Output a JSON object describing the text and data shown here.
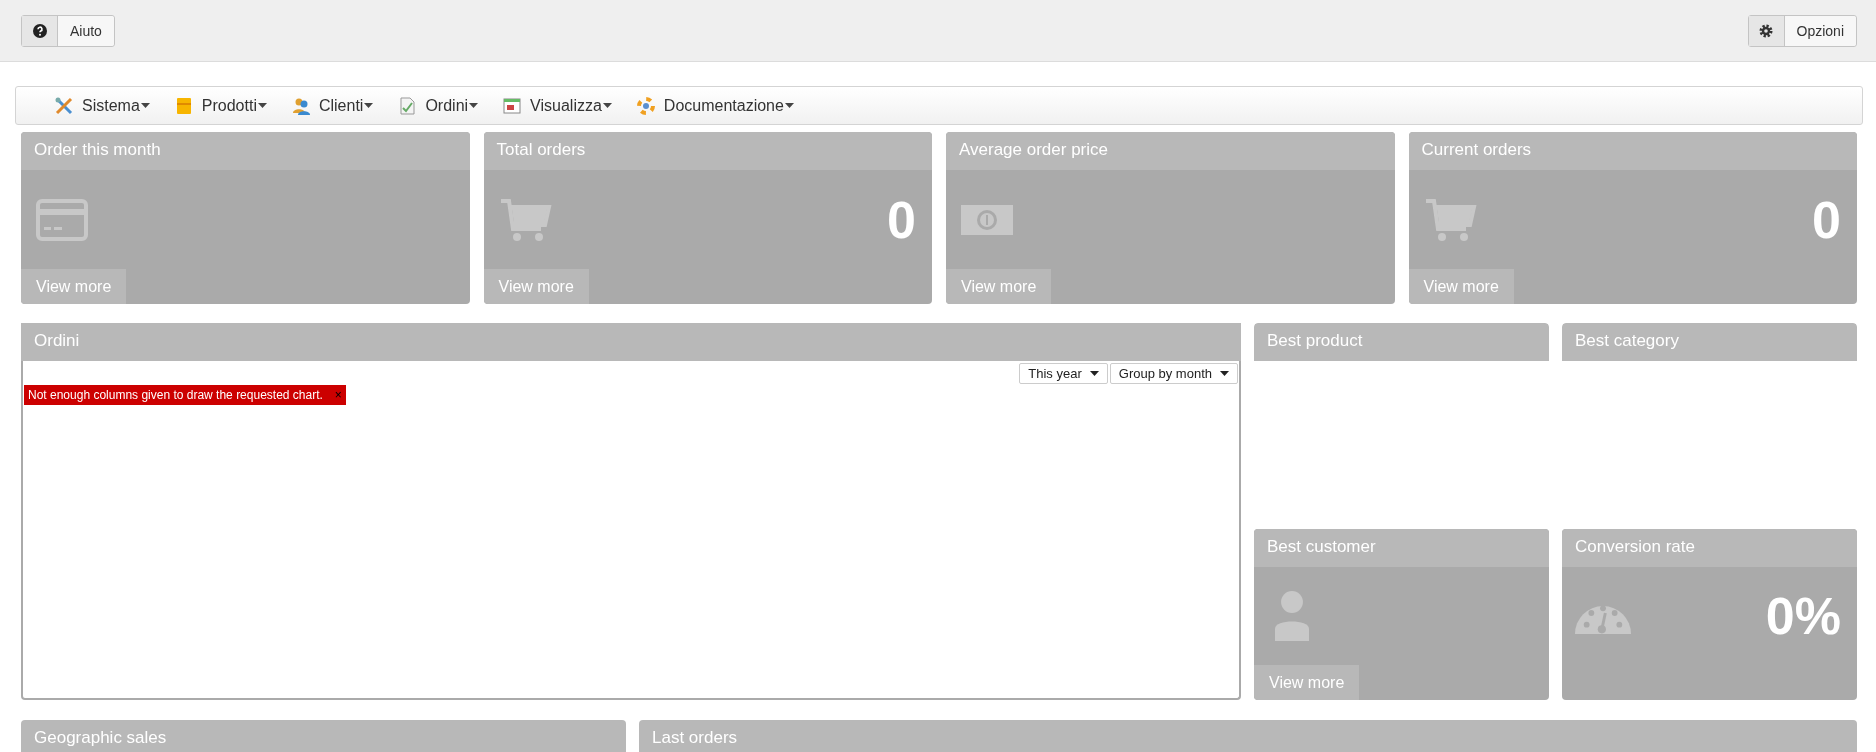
{
  "top_bar": {
    "help_button": {
      "label": "Aiuto"
    },
    "options_button": {
      "label": "Opzioni"
    }
  },
  "menu": {
    "items": [
      {
        "label": "Sistema"
      },
      {
        "label": "Prodotti"
      },
      {
        "label": "Clienti"
      },
      {
        "label": "Ordini"
      },
      {
        "label": "Visualizza"
      },
      {
        "label": "Documentazione"
      }
    ]
  },
  "stat_cards": [
    {
      "title": "Order this month",
      "link": "View more"
    },
    {
      "title": "Total orders",
      "value": "0",
      "link": "View more"
    },
    {
      "title": "Average order price",
      "link": "View more"
    },
    {
      "title": "Current orders",
      "value": "0",
      "link": "View more"
    }
  ],
  "orders_panel": {
    "title": "Ordini",
    "period_select": "This year",
    "group_select": "Group by month",
    "error": "Not enough columns given to draw the requested chart.",
    "error_close": "×"
  },
  "side_panels": [
    {
      "title": "Best product"
    },
    {
      "title": "Best category"
    },
    {
      "title": "Best customer",
      "link": "View more"
    },
    {
      "title": "Conversion rate",
      "value": "0%"
    }
  ],
  "bottom_panels": [
    {
      "title": "Geographic sales"
    },
    {
      "title": "Last orders"
    }
  ]
}
